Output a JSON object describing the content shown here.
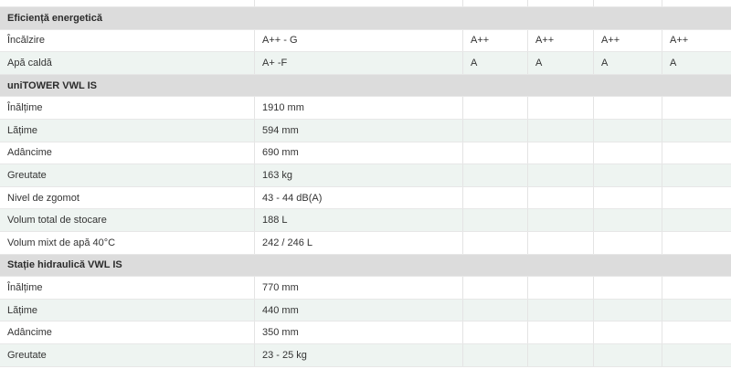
{
  "sections": [
    {
      "title": "Eficiență energetică",
      "rows": [
        {
          "label": "Încălzire",
          "value": "A++ - G",
          "cols": [
            "A++",
            "A++",
            "A++",
            "A++"
          ]
        },
        {
          "label": "Apă caldă",
          "value": "A+ -F",
          "cols": [
            "A",
            "A",
            "A",
            "A"
          ]
        }
      ]
    },
    {
      "title": "uniTOWER VWL IS",
      "rows": [
        {
          "label": "Înălțime",
          "value": "1910 mm",
          "cols": [
            "",
            "",
            "",
            ""
          ]
        },
        {
          "label": "Lățime",
          "value": "594 mm",
          "cols": [
            "",
            "",
            "",
            ""
          ]
        },
        {
          "label": "Adâncime",
          "value": "690 mm",
          "cols": [
            "",
            "",
            "",
            ""
          ]
        },
        {
          "label": "Greutate",
          "value": "163 kg",
          "cols": [
            "",
            "",
            "",
            ""
          ]
        },
        {
          "label": "Nivel de zgomot",
          "value": "43 - 44 dB(A)",
          "cols": [
            "",
            "",
            "",
            ""
          ]
        },
        {
          "label": "Volum total de stocare",
          "value": "188 L",
          "cols": [
            "",
            "",
            "",
            ""
          ]
        },
        {
          "label": "Volum mixt de apă 40°C",
          "value": "242 / 246 L",
          "cols": [
            "",
            "",
            "",
            ""
          ]
        }
      ]
    },
    {
      "title": "Stație hidraulică VWL IS",
      "rows": [
        {
          "label": "Înălțime",
          "value": "770 mm",
          "cols": [
            "",
            "",
            "",
            ""
          ]
        },
        {
          "label": "Lățime",
          "value": "440 mm",
          "cols": [
            "",
            "",
            "",
            ""
          ]
        },
        {
          "label": "Adâncime",
          "value": "350 mm",
          "cols": [
            "",
            "",
            "",
            ""
          ]
        },
        {
          "label": "Greutate",
          "value": "23 - 25 kg",
          "cols": [
            "",
            "",
            "",
            ""
          ]
        }
      ]
    }
  ],
  "colors": {
    "section_bg": "#dcdcdc",
    "alt_row_bg": "#eef4f1",
    "text": "#333333"
  }
}
